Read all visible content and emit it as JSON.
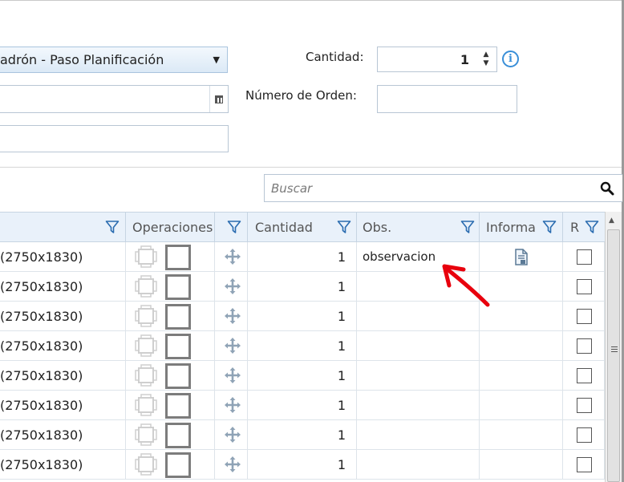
{
  "form": {
    "route_combo_value": "adrón - Paso Planificación",
    "quantity_label": "Cantidad:",
    "quantity_value": "1",
    "order_number_label": "Número de Orden:",
    "order_number_value": "",
    "date_value": "",
    "text_value": ""
  },
  "search": {
    "placeholder": "Buscar"
  },
  "grid": {
    "columns": [
      {
        "key": "size",
        "label": ""
      },
      {
        "key": "operations",
        "label": "Operaciones"
      },
      {
        "key": "move",
        "label": ""
      },
      {
        "key": "quantity",
        "label": "Cantidad"
      },
      {
        "key": "obs",
        "label": "Obs."
      },
      {
        "key": "informa",
        "label": "Informa"
      },
      {
        "key": "r",
        "label": "R"
      }
    ],
    "rows": [
      {
        "size": "(2750x1830)",
        "quantity": "1",
        "obs": "observacion",
        "has_report_icon": true
      },
      {
        "size": "(2750x1830)",
        "quantity": "1",
        "obs": "",
        "has_report_icon": false
      },
      {
        "size": "(2750x1830)",
        "quantity": "1",
        "obs": "",
        "has_report_icon": false
      },
      {
        "size": "(2750x1830)",
        "quantity": "1",
        "obs": "",
        "has_report_icon": false
      },
      {
        "size": "(2750x1830)",
        "quantity": "1",
        "obs": "",
        "has_report_icon": false
      },
      {
        "size": "(2750x1830)",
        "quantity": "1",
        "obs": "",
        "has_report_icon": false
      },
      {
        "size": "(2750x1830)",
        "quantity": "1",
        "obs": "",
        "has_report_icon": false
      },
      {
        "size": "(2750x1830)",
        "quantity": "1",
        "obs": "",
        "has_report_icon": false
      }
    ]
  },
  "icons": {
    "filter": "funnel-icon",
    "search": "magnifier-icon",
    "info": "info-icon",
    "move": "move-arrows-icon",
    "report": "document-icon",
    "annotation": "red-arrow-icon"
  },
  "colors": {
    "accent": "#3a8fd8",
    "header_bg": "#e9f1fa",
    "annotation": "#e8000d"
  }
}
